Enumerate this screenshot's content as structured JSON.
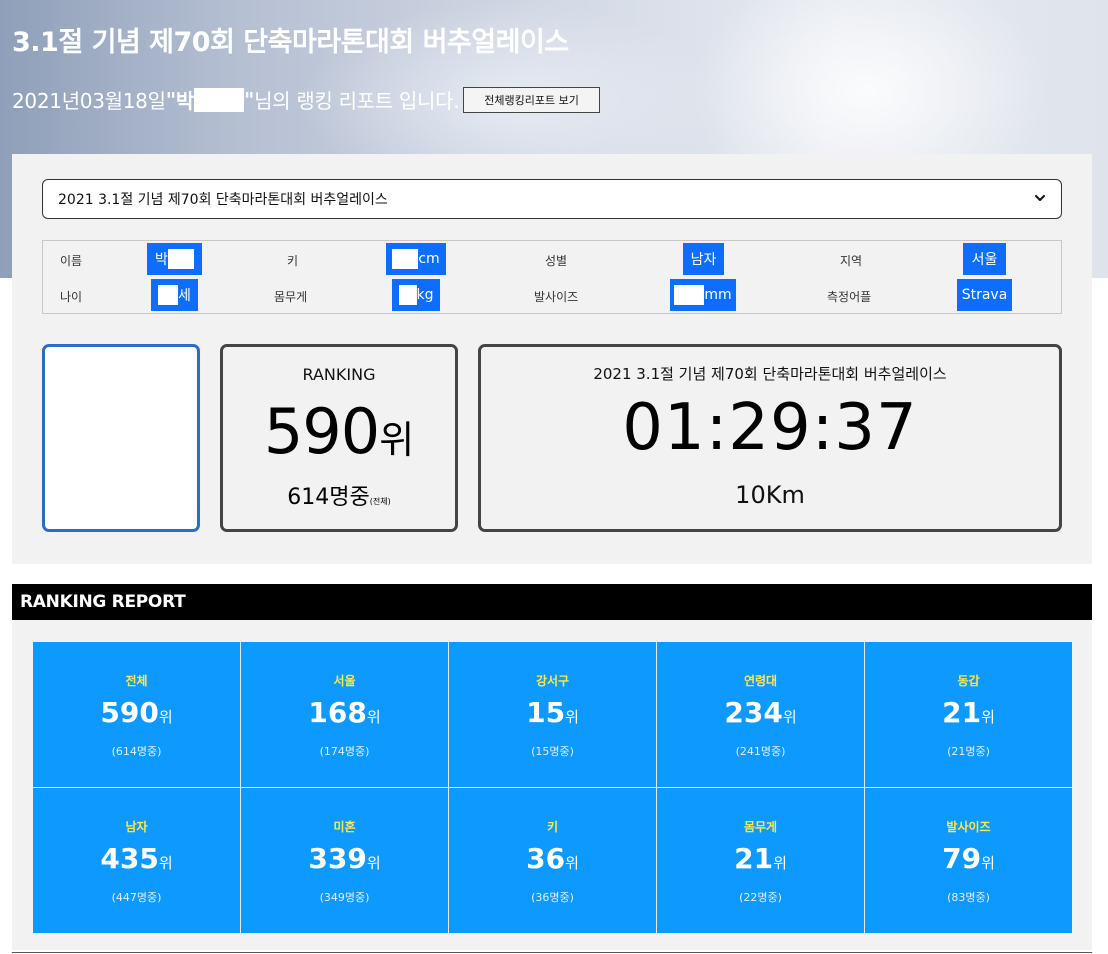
{
  "header": {
    "title": "3.1절 기념 제70회 단축마라톤대회 버추얼레이스",
    "date_prefix": "2021년03월18일",
    "quote_open": "\"",
    "name_visible": "박",
    "quote_close": "\"",
    "suffix": " 님의 랭킹 리포트 입니다.",
    "report_button_label": "전체랭킹리포트 보기"
  },
  "race_select": {
    "selected": "2021 3.1절 기념 제70회 단축마라톤대회 버추얼레이스"
  },
  "profile": {
    "name_label": "이름",
    "name_value": "박",
    "height_label": "키",
    "height_unit": "cm",
    "gender_label": "성별",
    "gender_value": "남자",
    "region_label": "지역",
    "region_value": "서울",
    "age_label": "나이",
    "age_unit": "세",
    "weight_label": "몸무게",
    "weight_unit": "kg",
    "shoe_label": "발사이즈",
    "shoe_unit": "mm",
    "device_label": "측정어플",
    "device_value": "Strava"
  },
  "ranking_card": {
    "label": "RANKING",
    "rank": "590",
    "rank_unit": "위",
    "total": "614명중",
    "total_note": "(전체)"
  },
  "time_card": {
    "race_name": "2021 3.1절 기념 제70회 단축마라톤대회 버추얼레이스",
    "time": "01:29:37",
    "distance": "10Km"
  },
  "report": {
    "title": "RANKING REPORT",
    "unit": "위",
    "tiles": [
      {
        "name": "전체",
        "rank": "590",
        "total": "(614명중)"
      },
      {
        "name": "서울",
        "rank": "168",
        "total": "(174명중)"
      },
      {
        "name": "강서구",
        "rank": "15",
        "total": "(15명중)"
      },
      {
        "name": "연령대",
        "rank": "234",
        "total": "(241명중)"
      },
      {
        "name": "동갑",
        "rank": "21",
        "total": "(21명중)"
      },
      {
        "name": "남자",
        "rank": "435",
        "total": "(447명중)"
      },
      {
        "name": "미혼",
        "rank": "339",
        "total": "(349명중)"
      },
      {
        "name": "키",
        "rank": "36",
        "total": "(36명중)"
      },
      {
        "name": "몸무게",
        "rank": "21",
        "total": "(22명중)"
      },
      {
        "name": "발사이즈",
        "rank": "79",
        "total": "(83명중)"
      }
    ]
  }
}
